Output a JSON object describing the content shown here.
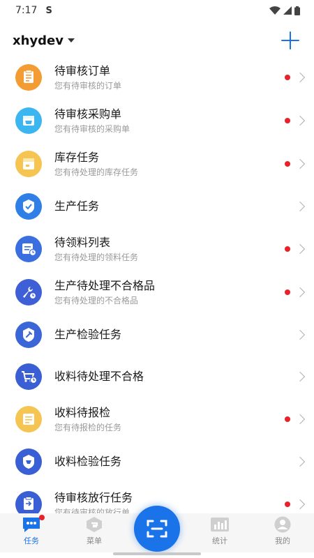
{
  "status_bar": {
    "time": "7:17",
    "sync_glyph": "S"
  },
  "header": {
    "account": "xhydev"
  },
  "tasks": [
    {
      "title": "待审核订单",
      "subtitle": "您有待审核的订单",
      "dot": true,
      "icon": "clipboard-icon",
      "color": "#f39c33"
    },
    {
      "title": "待审核采购单",
      "subtitle": "您有待审核的采购单",
      "dot": true,
      "icon": "basket-icon",
      "color": "#3cb6f0"
    },
    {
      "title": "库存任务",
      "subtitle": "您有待处理的库存任务",
      "dot": true,
      "icon": "inventory-icon",
      "color": "#f5c451"
    },
    {
      "title": "生产任务",
      "subtitle": "",
      "dot": false,
      "icon": "check-badge-icon",
      "color": "#2f7fe6"
    },
    {
      "title": "待领料列表",
      "subtitle": "您有待处理的领料任务",
      "dot": true,
      "icon": "material-list-icon",
      "color": "#3b6fe0"
    },
    {
      "title": "生产待处理不合格品",
      "subtitle": "您有待处理的不合格品",
      "dot": true,
      "icon": "wrench-clock-icon",
      "color": "#3f5fd6"
    },
    {
      "title": "生产检验任务",
      "subtitle": "",
      "dot": false,
      "icon": "shield-wrench-icon",
      "color": "#3b66d8"
    },
    {
      "title": "收料待处理不合格",
      "subtitle": "",
      "dot": false,
      "icon": "cart-clock-icon",
      "color": "#3a5fd4"
    },
    {
      "title": "收料待报检",
      "subtitle": "您有待报检的任务",
      "dot": true,
      "icon": "report-icon",
      "color": "#f5c451"
    },
    {
      "title": "收料检验任务",
      "subtitle": "",
      "dot": false,
      "icon": "shield-icon",
      "color": "#3a5fd4"
    },
    {
      "title": "待审核放行任务",
      "subtitle": "您有待审核的放行单",
      "dot": true,
      "icon": "release-doc-icon",
      "color": "#3a5fd4"
    }
  ],
  "bottom_nav": [
    {
      "label": "任务",
      "icon": "task-chat-icon",
      "active": true
    },
    {
      "label": "菜单",
      "icon": "menu-cube-icon",
      "active": false
    },
    {
      "label": "统计",
      "icon": "bar-chart-icon",
      "active": false
    },
    {
      "label": "我的",
      "icon": "user-icon",
      "active": false
    }
  ],
  "colors": {
    "accent": "#1a73e8",
    "badge": "#e8212a"
  }
}
